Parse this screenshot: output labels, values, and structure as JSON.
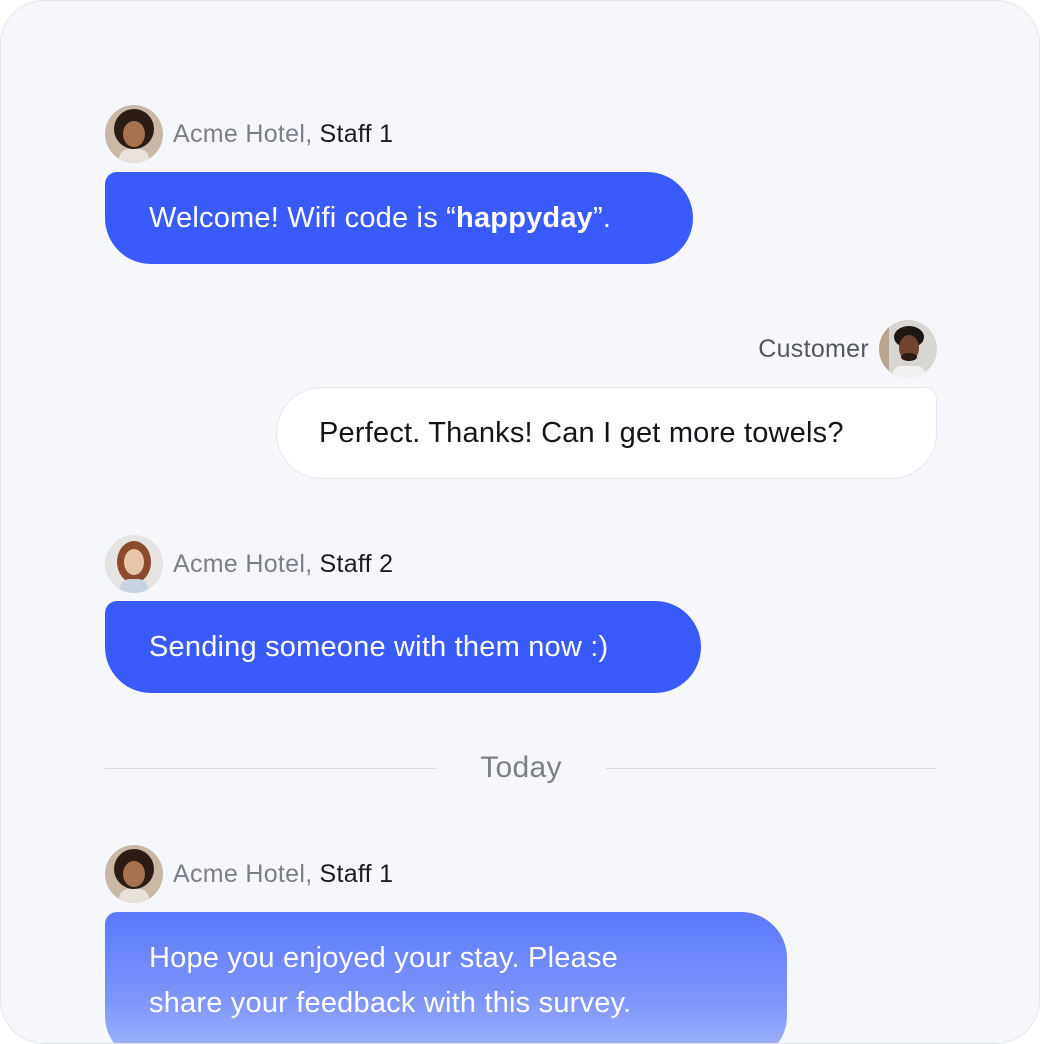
{
  "messages": [
    {
      "sender_org": "Acme Hotel",
      "sender_sep": ",",
      "sender_name": "Staff 1",
      "text_before": "Welcome! Wifi code is “",
      "text_bold": "happyday",
      "text_after": "”."
    },
    {
      "sender_name": "Customer",
      "text": "Perfect. Thanks! Can I get more towels?"
    },
    {
      "sender_org": "Acme Hotel",
      "sender_sep": ",",
      "sender_name": "Staff 2",
      "text": "Sending someone with them now :)"
    },
    {
      "sender_org": "Acme Hotel",
      "sender_sep": ",",
      "sender_name": "Staff 1",
      "text_line1": "Hope you enjoyed your stay. Please",
      "text_line2": "share your feedback with this survey."
    }
  ],
  "divider": {
    "label": "Today"
  },
  "colors": {
    "staff_bubble": "#3a5bfb",
    "customer_bubble": "#ffffff",
    "background": "#f6f7fb",
    "muted_text": "#7d7f88"
  }
}
